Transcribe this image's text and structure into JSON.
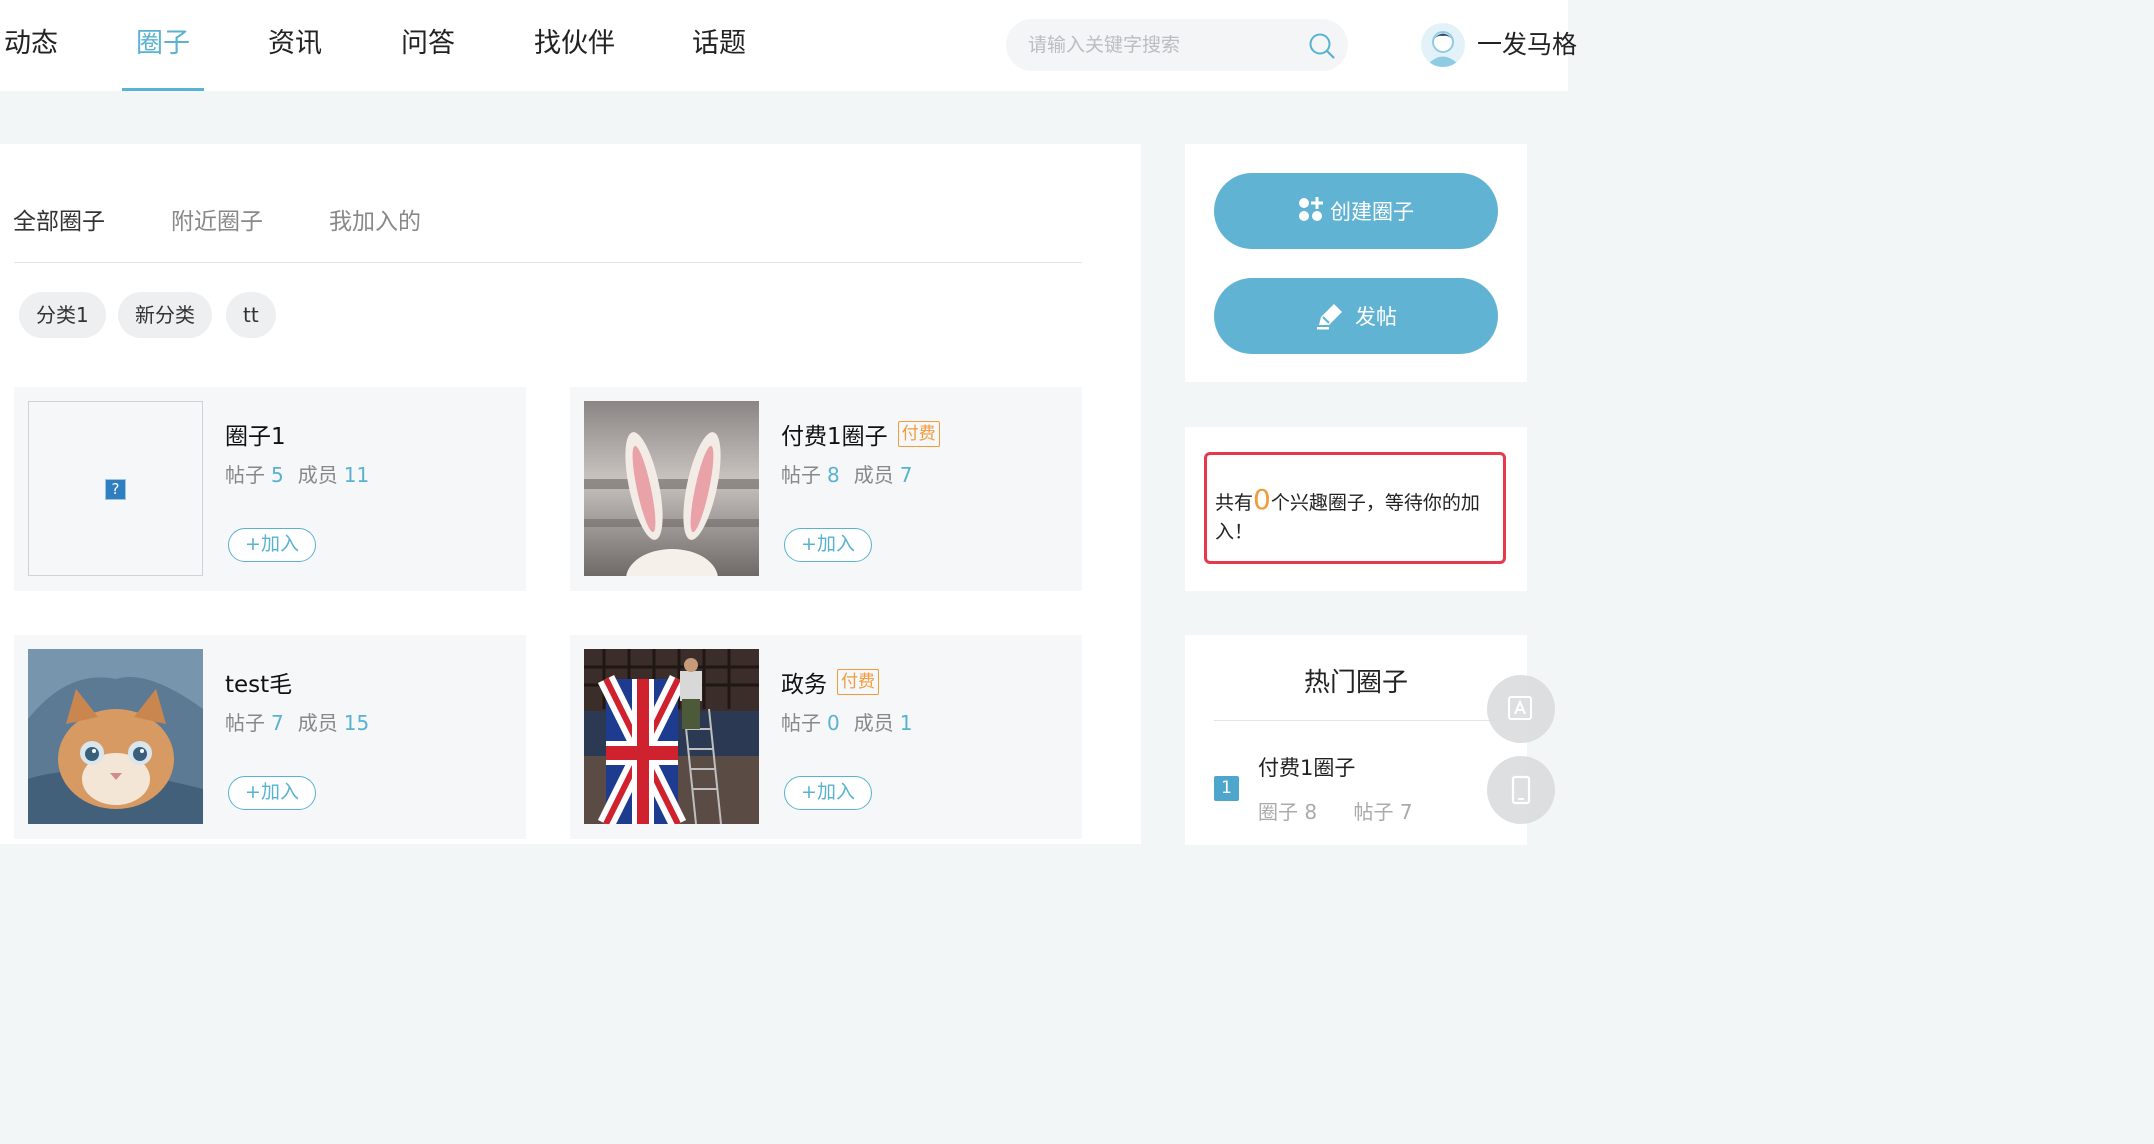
{
  "nav": {
    "items": [
      {
        "label": "动态",
        "active": false
      },
      {
        "label": "圈子",
        "active": true
      },
      {
        "label": "资讯",
        "active": false
      },
      {
        "label": "问答",
        "active": false
      },
      {
        "label": "找伙伴",
        "active": false
      },
      {
        "label": "话题",
        "active": false
      }
    ],
    "search_placeholder": "请输入关键字搜索",
    "username": "一发马格"
  },
  "tabs": [
    "全部圈子",
    "附近圈子",
    "我加入的"
  ],
  "categories": [
    "分类1",
    "新分类",
    "tt"
  ],
  "labels": {
    "posts": "帖子",
    "members": "成员",
    "join": "+加入",
    "paid": "付费"
  },
  "circles": [
    {
      "name": "圈子1",
      "paid": false,
      "posts": "5",
      "members": "11",
      "image": "broken-image"
    },
    {
      "name": "付费1圈子",
      "paid": true,
      "posts": "8",
      "members": "7",
      "image": "bunny-ears-photo"
    },
    {
      "name": "test毛",
      "paid": false,
      "posts": "7",
      "members": "15",
      "image": "kitten-photo"
    },
    {
      "name": "政务",
      "paid": true,
      "posts": "0",
      "members": "1",
      "image": "union-jack-photo"
    }
  ],
  "sidebar": {
    "create_label": "创建圈子",
    "post_label": "发帖",
    "notice_prefix": "共有",
    "notice_count": "0",
    "notice_suffix": "个兴趣圈子，等待你的加入！",
    "hot_title": "热门圈子",
    "hot_list": [
      {
        "rank": "1",
        "name": "付费1圈子",
        "circle_label": "圈子",
        "circle_count": "8",
        "post_label": "帖子",
        "post_count": "7"
      }
    ]
  },
  "colors": {
    "accent": "#59b2d1",
    "paid": "#f29b3a",
    "notice_border": "#e8384b"
  }
}
